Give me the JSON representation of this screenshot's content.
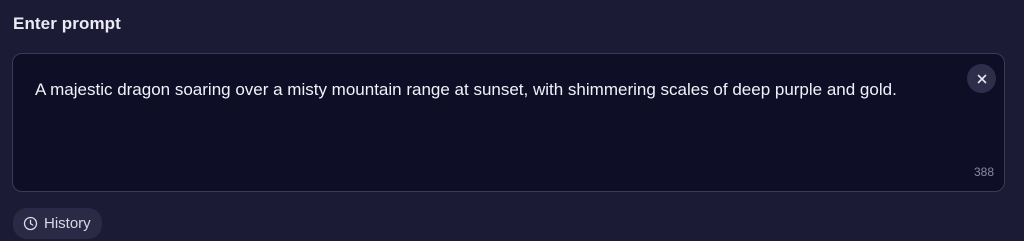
{
  "prompt": {
    "label": "Enter prompt",
    "value": "A majestic dragon soaring over a misty mountain range at sunset, with shimmering scales of deep purple and gold.",
    "char_count": "388",
    "clear_icon": "close-icon"
  },
  "history": {
    "label": "History",
    "icon": "clock-icon"
  },
  "colors": {
    "background": "#1c1b35",
    "input_background": "#0f0e27",
    "input_border": "#3b3a58",
    "text": "#f2f1fa",
    "muted_text": "#8b8aa3"
  }
}
